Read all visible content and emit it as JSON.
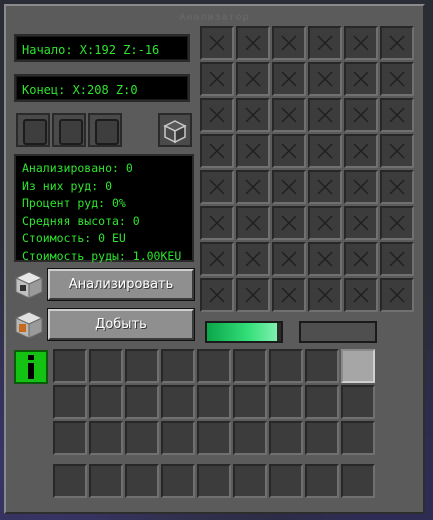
{
  "window": {
    "title": "Анализатор"
  },
  "coords": {
    "start": "Начало: X:192 Z:-16",
    "end": "Конец: X:208 Z:0"
  },
  "stats": {
    "analyzed": "Анализировано: 0",
    "ores": "Из них руд: 0",
    "ore_percent": "Процент руд: 0%",
    "avg_height": "Средняя высота: 0",
    "cost": "Стоимость: 0 EU",
    "ore_cost": "Стоимость руды: 1.00KEU"
  },
  "buttons": {
    "analyze": "Анализировать",
    "mine": "Добыть"
  },
  "energy": {
    "fill": 0.95
  },
  "progress": {
    "fill": 0
  },
  "colors": {
    "text_green": "#2ee52e",
    "panel": "#5b5b5b",
    "slot": "#3c3c3c",
    "info_icon": "#13c213"
  },
  "icons": [
    "upgrade-slot-icon",
    "cube-icon",
    "analyzer-machine-icon",
    "miner-machine-icon",
    "info-icon",
    "x-icon"
  ]
}
